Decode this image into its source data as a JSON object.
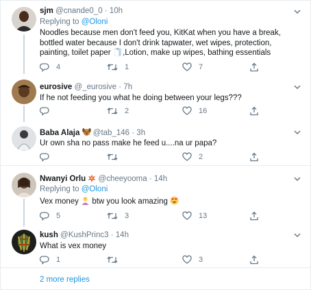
{
  "tweets": [
    {
      "name": "sjm",
      "handle": "@cnande0_0",
      "time": "10h",
      "replying_prefix": "Replying to",
      "replying_to": "@Oloni",
      "text": "Noodles because men don't feed you, KitKat when you have a break, bottled water because I don't drink tapwater, wet wipes, protection, painting, toilet paper 🧻,Lotion, make up wipes, bathing essentials",
      "replies": "4",
      "retweets": "1",
      "likes": "7"
    },
    {
      "name": "eurosive",
      "handle": "@_eurosive",
      "time": "7h",
      "text": "If he not feeding you what he doing between your legs???",
      "replies": "",
      "retweets": "2",
      "likes": "16"
    },
    {
      "name": "Baba Alaja",
      "handle": "@tab_146",
      "time": "3h",
      "name_emoji": "dog-face-emoji",
      "text": "Ur own sha no pass make he feed u....na ur papa?",
      "replies": "",
      "retweets": "",
      "likes": "2"
    },
    {
      "name": "Nwanyi Orlu",
      "handle": "@cheeyooma",
      "time": "14h",
      "name_emoji": "collision-emoji",
      "replying_prefix": "Replying to",
      "replying_to": "@Oloni",
      "text_a": "Vex money",
      "text_b": " btw you look amazing",
      "replies": "5",
      "retweets": "3",
      "likes": "13"
    },
    {
      "name": "kush",
      "handle": "@KushPrinc3",
      "time": "14h",
      "text": "What is vex money",
      "replies": "1",
      "retweets": "",
      "likes": "3"
    }
  ],
  "show_more": "2 more replies",
  "icons": {
    "reply": "reply-icon",
    "retweet": "retweet-icon",
    "like": "heart-icon",
    "share": "share-icon",
    "caret": "chevron-down-icon"
  },
  "colors": {
    "link": "#1b95e0",
    "secondary": "#657786",
    "text": "#14171a",
    "divider": "#e6ecf0",
    "thread": "#ccd6dd"
  }
}
